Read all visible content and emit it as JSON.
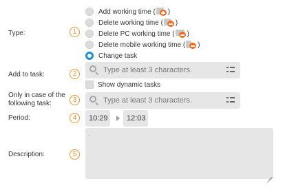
{
  "type_field": {
    "label": "Type:",
    "step": "1",
    "options": [
      {
        "label": "Add working time (",
        "icon": "clock-add-icon",
        "close": ")",
        "checked": false
      },
      {
        "label": "Delete working time (",
        "icon": "clock-delete-icon",
        "close": ")",
        "checked": false
      },
      {
        "label": "Delete PC working time (",
        "icon": "pc-delete-icon",
        "close": ")",
        "checked": false
      },
      {
        "label": "Delete mobile working time (",
        "icon": "mobile-delete-icon",
        "close": ")",
        "checked": false
      },
      {
        "label": "Change task",
        "checked": true
      }
    ]
  },
  "add_to_task": {
    "label": "Add to task:",
    "step": "2",
    "placeholder": "Type at least 3 characters.",
    "show_dynamic_label": "Show dynamic tasks"
  },
  "following_task": {
    "label_line1": "Only in case of the",
    "label_line2": "following task:",
    "step": "3",
    "placeholder": "Type at least 3 characters."
  },
  "period": {
    "label": "Period:",
    "step": "4",
    "start": "10:29",
    "end": "12:03"
  },
  "description": {
    "label": "Description:",
    "step": "5",
    "value": "."
  },
  "colors": {
    "accent_orange": "#e8942a",
    "radio_selected": "#1c8fdb",
    "field_bg": "#e6e6e6"
  }
}
